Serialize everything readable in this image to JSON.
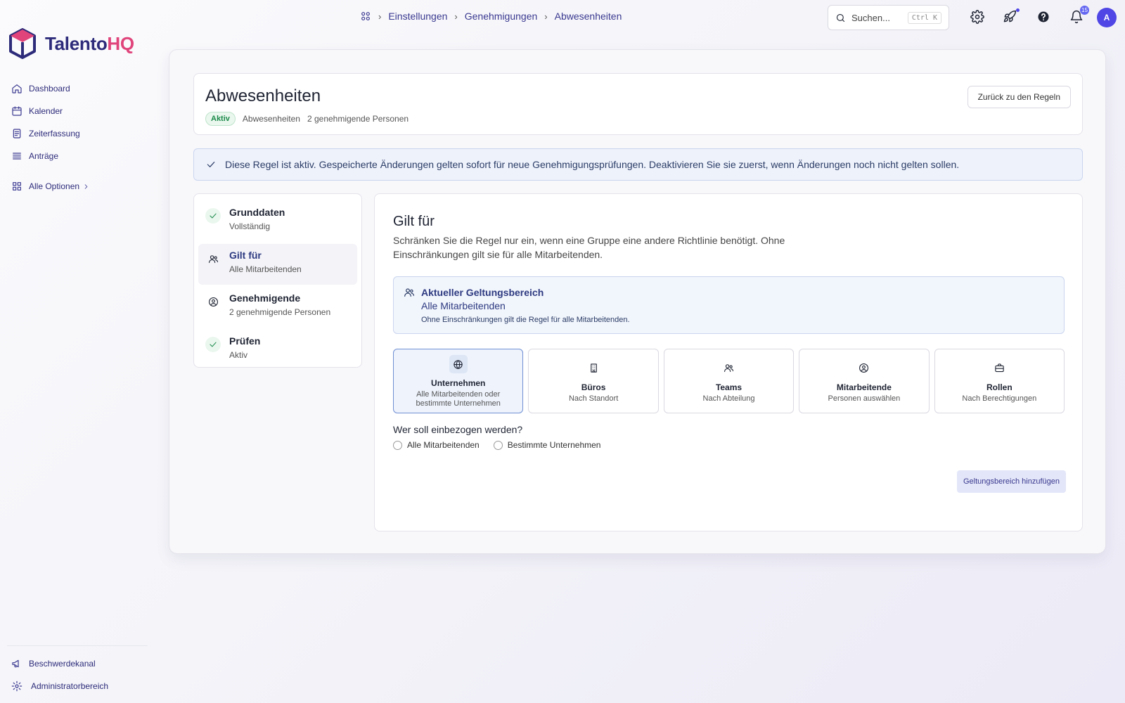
{
  "app": {
    "logo_main": "Talento",
    "logo_accent": "HQ"
  },
  "sidebar": {
    "items": [
      {
        "label": "Dashboard",
        "icon": "home-icon"
      },
      {
        "label": "Kalender",
        "icon": "calendar-icon"
      },
      {
        "label": "Zeiterfassung",
        "icon": "timesheet-icon"
      },
      {
        "label": "Anträge",
        "icon": "list-icon"
      }
    ],
    "all_options": "Alle Optionen",
    "bottom": [
      {
        "label": "Beschwerdekanal",
        "icon": "megaphone-icon"
      },
      {
        "label": "Administratorbereich",
        "icon": "gear-icon"
      }
    ]
  },
  "breadcrumb": [
    "Einstellungen",
    "Genehmigungen",
    "Abwesenheiten"
  ],
  "search": {
    "placeholder": "Suchen...",
    "shortcut": "Ctrl K"
  },
  "topbar": {
    "notification_count": "15",
    "avatar_initial": "A"
  },
  "header": {
    "title": "Abwesenheiten",
    "status": "Aktiv",
    "category": "Abwesenheiten",
    "approvers": "2 genehmigende Personen",
    "back_label": "Zurück zu den Regeln"
  },
  "alert": {
    "text": "Diese Regel ist aktiv. Gespeicherte Änderungen gelten sofort für neue Genehmigungsprüfungen. Deaktivieren Sie sie zuerst, wenn Änderungen noch nicht gelten sollen."
  },
  "steps": [
    {
      "title": "Grunddaten",
      "sub": "Vollständig"
    },
    {
      "title": "Gilt für",
      "sub": "Alle Mitarbeitenden"
    },
    {
      "title": "Genehmigende",
      "sub": "2 genehmigende Personen"
    },
    {
      "title": "Prüfen",
      "sub": "Aktiv"
    }
  ],
  "content": {
    "title": "Gilt für",
    "description": "Schränken Sie die Regel nur ein, wenn eine Gruppe eine andere Richtlinie benötigt. Ohne Einschränkungen gilt sie für alle Mitarbeitenden.",
    "scope": {
      "title": "Aktueller Geltungsbereich",
      "value": "Alle Mitarbeitenden",
      "note": "Ohne Einschränkungen gilt die Regel für alle Mitarbeitenden."
    },
    "options": [
      {
        "title": "Unternehmen",
        "sub": "Alle Mitarbeitenden oder bestimmte Unternehmen",
        "icon": "globe-icon"
      },
      {
        "title": "Büros",
        "sub": "Nach Standort",
        "icon": "building-icon"
      },
      {
        "title": "Teams",
        "sub": "Nach Abteilung",
        "icon": "team-icon"
      },
      {
        "title": "Mitarbeitende",
        "sub": "Personen auswählen",
        "icon": "person-circle-icon"
      },
      {
        "title": "Rollen",
        "sub": "Nach Berechtigungen",
        "icon": "briefcase-icon"
      }
    ],
    "question": "Wer soll einbezogen werden?",
    "radio_options": [
      "Alle Mitarbeitenden",
      "Bestimmte Unternehmen"
    ],
    "add_button": "Geltungsbereich hinzufügen"
  },
  "colors": {
    "accent": "#4f46e5",
    "brand": "#2d2b7a",
    "brand_accent": "#e0447a",
    "success": "#1b8a4a"
  }
}
